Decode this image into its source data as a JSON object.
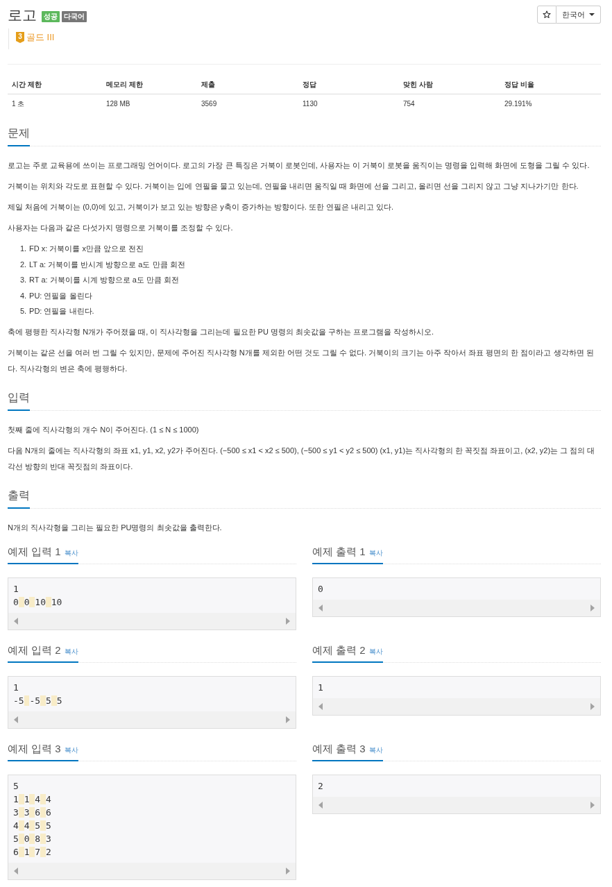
{
  "header": {
    "title": "로고",
    "badges": [
      {
        "label": "성공",
        "color": "#5cb85c"
      },
      {
        "label": "다국어",
        "color": "#777777"
      }
    ],
    "tier": {
      "rank": "3",
      "label": "골드 III"
    },
    "language": "한국어"
  },
  "stats_table": {
    "columns": [
      "시간 제한",
      "메모리 제한",
      "제출",
      "정답",
      "맞힌 사람",
      "정답 비율"
    ],
    "rows": [
      [
        "1 초",
        "128 MB",
        "3569",
        "1130",
        "754",
        "29.191%"
      ]
    ]
  },
  "sections": [
    {
      "title": "문제",
      "blocks": [
        {
          "kind": "paragraph",
          "text": "로고는 주로 교육용에 쓰이는 프로그래밍 언어이다. 로고의 가장 큰 특징은 거북이 로봇인데, 사용자는 이 거북이 로봇을 움직이는 명령을 입력해 화면에 도형을 그릴 수 있다."
        },
        {
          "kind": "paragraph",
          "text": "거북이는 위치와 각도로 표현할 수 있다. 거북이는 입에 연필을 물고 있는데, 연필을 내리면 움직일 때 화면에 선을 그리고, 올리면 선을 그리지 않고 그냥 지나가기만 한다."
        },
        {
          "kind": "paragraph",
          "text": "제일 처음에 거북이는 (0,0)에 있고, 거북이가 보고 있는 방향은 y축이 증가하는 방향이다. 또한 연필은 내리고 있다."
        },
        {
          "kind": "paragraph",
          "text": "사용자는 다음과 같은 다섯가지 명령으로 거북이를 조정할 수 있다."
        },
        {
          "kind": "list",
          "items": [
            {
              "number": "1.",
              "text": "FD x: 거북이를 x만큼 앞으로 전진"
            },
            {
              "number": "2.",
              "text": "LT a: 거북이를 반시계 방향으로 a도 만큼 회전"
            },
            {
              "number": "3.",
              "text": "RT a: 거북이를 시계 방향으로 a도 만큼 회전"
            },
            {
              "number": "4.",
              "text": "PU: 연필을 올린다"
            },
            {
              "number": "5.",
              "text": "PD: 연필을 내린다."
            }
          ]
        },
        {
          "kind": "paragraph",
          "text": "축에 평행한 직사각형 N개가 주어졌을 때, 이 직사각형을 그리는데 필요한 PU 명령의 최솟값을 구하는 프로그램을 작성하시오."
        },
        {
          "kind": "paragraph",
          "text": "거북이는 같은 선을 여러 번 그릴 수 있지만, 문제에 주어진 직사각형 N개를 제외한 어떤 것도 그릴 수 없다. 거북이의 크기는 아주 작아서 좌표 평면의 한 점이라고 생각하면 된다. 직사각형의 변은 축에 평행하다."
        }
      ]
    },
    {
      "title": "입력",
      "blocks": [
        {
          "kind": "paragraph",
          "text": "첫째 줄에 직사각형의 개수 N이 주어진다. (1 ≤ N ≤ 1000)"
        },
        {
          "kind": "paragraph",
          "text": "다음 N개의 줄에는 직사각형의 좌표 x1, y1, x2, y2가 주어진다. (−500 ≤ x1 < x2 ≤ 500), (−500 ≤ y1 < y2 ≤ 500) (x1, y1)는 직사각형의 한 꼭짓점 좌표이고, (x2, y2)는 그 점의 대각선 방향의 반대 꼭짓점의 좌표이다."
        }
      ]
    },
    {
      "title": "출력",
      "blocks": [
        {
          "kind": "paragraph",
          "text": "N개의 직사각형을 그리는 필요한 PU명령의 최솟값을 출력한다."
        }
      ]
    }
  ],
  "samples": [
    {
      "input": {
        "title": "예제 입력 1",
        "copy": "복사",
        "lines": [
          "1",
          "0 0 10 10"
        ]
      },
      "output": {
        "title": "예제 출력 1",
        "copy": "복사",
        "lines": [
          "0"
        ]
      }
    },
    {
      "input": {
        "title": "예제 입력 2",
        "copy": "복사",
        "lines": [
          "1",
          "-5 -5 5 5"
        ]
      },
      "output": {
        "title": "예제 출력 2",
        "copy": "복사",
        "lines": [
          "1"
        ]
      }
    },
    {
      "input": {
        "title": "예제 입력 3",
        "copy": "복사",
        "lines": [
          "5",
          "1 1 4 4",
          "3 3 6 6",
          "4 4 5 5",
          "5 0 8 3",
          "6 1 7 2"
        ]
      },
      "output": {
        "title": "예제 출력 3",
        "copy": "복사",
        "lines": [
          "2"
        ]
      }
    }
  ]
}
